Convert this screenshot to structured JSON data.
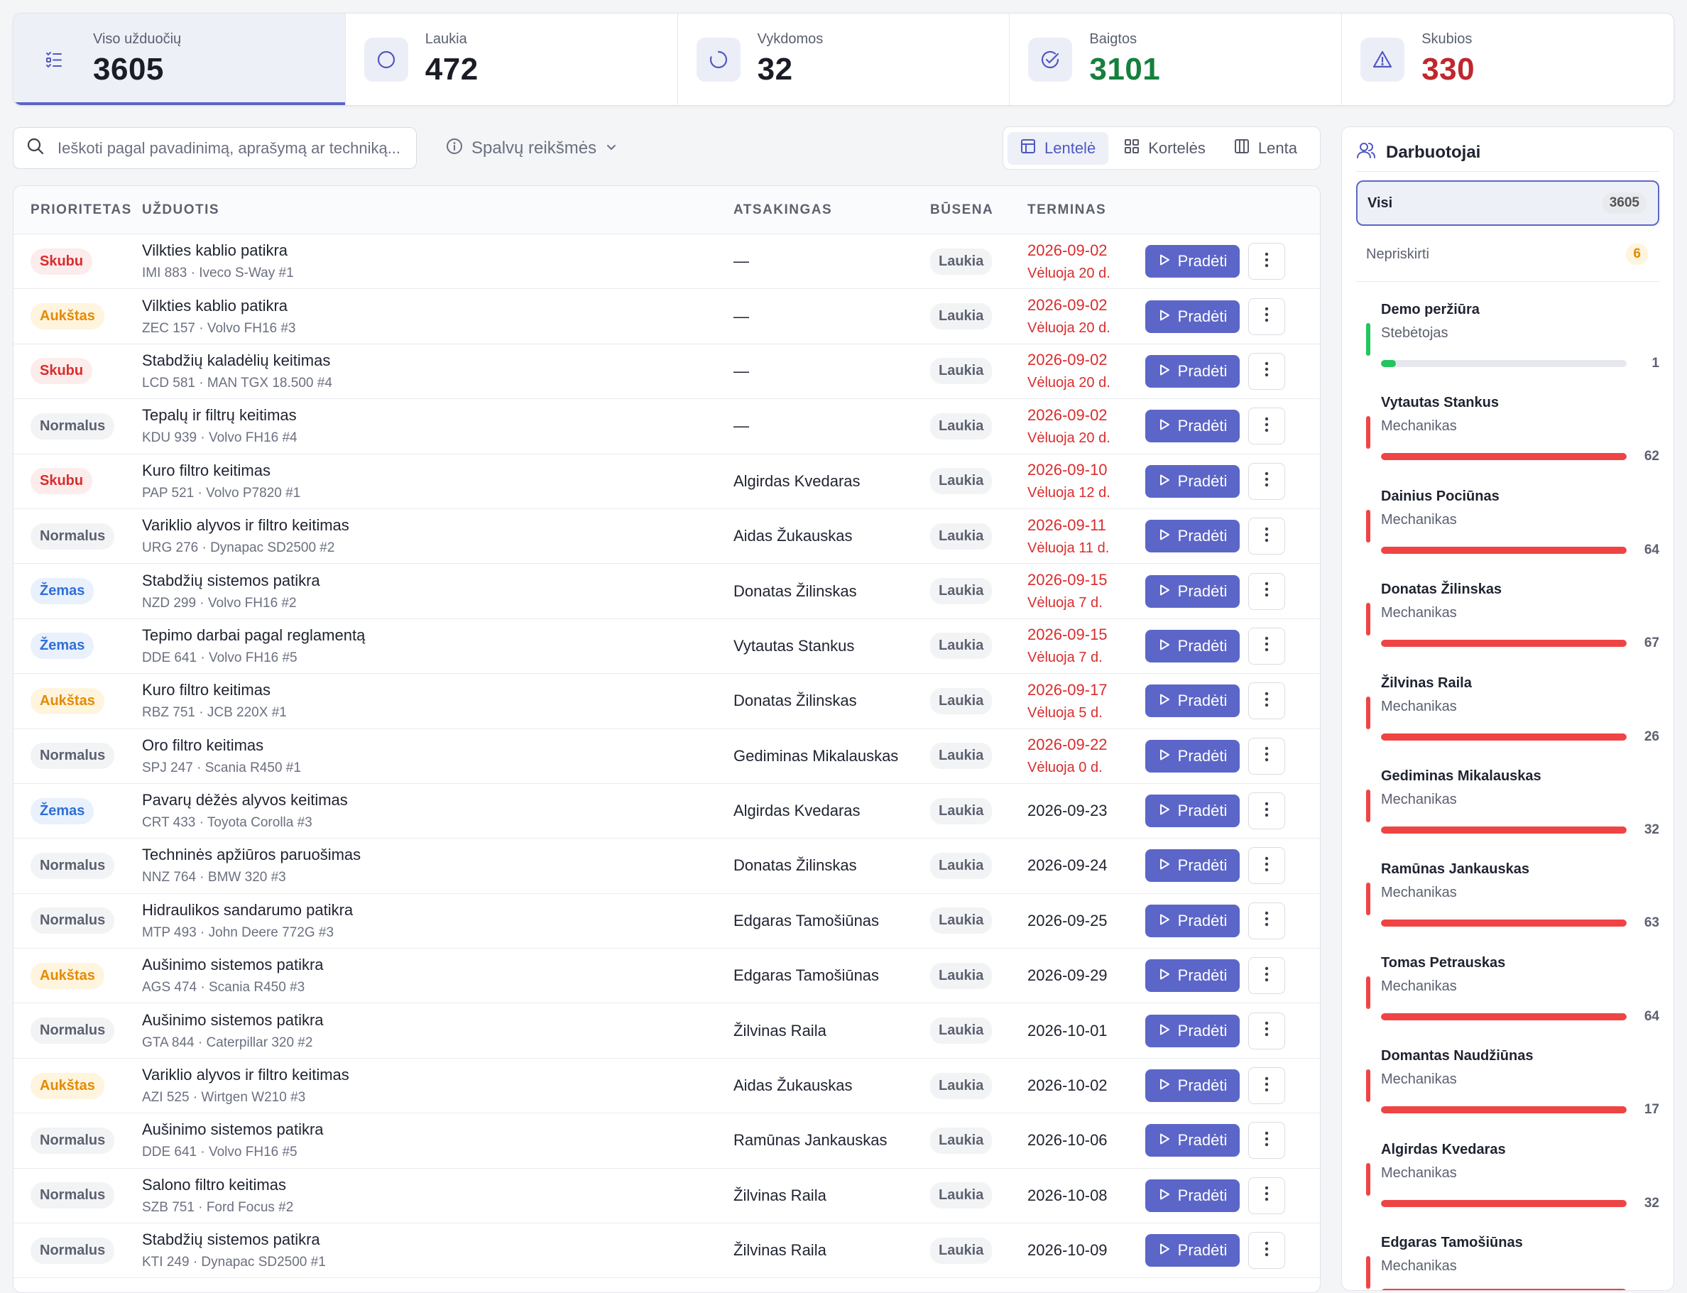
{
  "stats": [
    {
      "label": "Viso užduočių",
      "value": "3605",
      "tone": "default",
      "icon": "checklist-icon",
      "active": true
    },
    {
      "label": "Laukia",
      "value": "472",
      "tone": "default",
      "icon": "circle-icon",
      "active": false
    },
    {
      "label": "Vykdomos",
      "value": "32",
      "tone": "default",
      "icon": "loading-spinner-icon",
      "active": false
    },
    {
      "label": "Baigtos",
      "value": "3101",
      "tone": "green",
      "icon": "check-circle-icon",
      "active": false
    },
    {
      "label": "Skubios",
      "value": "330",
      "tone": "red",
      "icon": "warning-triangle-icon",
      "active": false
    }
  ],
  "search": {
    "placeholder": "Ieškoti pagal pavadinimą, aprašymą ar techniką..."
  },
  "legend_button": {
    "label": "Spalvų reikšmės"
  },
  "views": [
    {
      "label": "Lentelė",
      "icon": "table-icon",
      "active": true
    },
    {
      "label": "Kortelės",
      "icon": "grid-icon",
      "active": false
    },
    {
      "label": "Lenta",
      "icon": "kanban-icon",
      "active": false
    }
  ],
  "table": {
    "headers": {
      "priority": "PRIORITETAS",
      "task": "UŽDUOTIS",
      "assignee": "ATSAKINGAS",
      "status": "BŪSENA",
      "due": "TERMINAS"
    },
    "start_label": "Pradėti",
    "rows": [
      {
        "priority": "Skubu",
        "pclass": "skubu",
        "title": "Vilkties kablio patikra",
        "sub": "IMI 883 · Iveco S-Way #1",
        "assignee": "—",
        "status": "Laukia",
        "due": "2026-09-02",
        "late": "Vėluoja 20 d."
      },
      {
        "priority": "Aukštas",
        "pclass": "aukstas",
        "title": "Vilkties kablio patikra",
        "sub": "ZEC 157 · Volvo FH16 #3",
        "assignee": "—",
        "status": "Laukia",
        "due": "2026-09-02",
        "late": "Vėluoja 20 d."
      },
      {
        "priority": "Skubu",
        "pclass": "skubu",
        "title": "Stabdžių kaladėlių keitimas",
        "sub": "LCD 581 · MAN TGX 18.500 #4",
        "assignee": "—",
        "status": "Laukia",
        "due": "2026-09-02",
        "late": "Vėluoja 20 d."
      },
      {
        "priority": "Normalus",
        "pclass": "normalus",
        "title": "Tepalų ir filtrų keitimas",
        "sub": "KDU 939 · Volvo FH16 #4",
        "assignee": "—",
        "status": "Laukia",
        "due": "2026-09-02",
        "late": "Vėluoja 20 d."
      },
      {
        "priority": "Skubu",
        "pclass": "skubu",
        "title": "Kuro filtro keitimas",
        "sub": "PAP 521 · Volvo P7820 #1",
        "assignee": "Algirdas Kvedaras",
        "status": "Laukia",
        "due": "2026-09-10",
        "late": "Vėluoja 12 d."
      },
      {
        "priority": "Normalus",
        "pclass": "normalus",
        "title": "Variklio alyvos ir filtro keitimas",
        "sub": "URG 276 · Dynapac SD2500 #2",
        "assignee": "Aidas Žukauskas",
        "status": "Laukia",
        "due": "2026-09-11",
        "late": "Vėluoja 11 d."
      },
      {
        "priority": "Žemas",
        "pclass": "zemas",
        "title": "Stabdžių sistemos patikra",
        "sub": "NZD 299 · Volvo FH16 #2",
        "assignee": "Donatas Žilinskas",
        "status": "Laukia",
        "due": "2026-09-15",
        "late": "Vėluoja 7 d."
      },
      {
        "priority": "Žemas",
        "pclass": "zemas",
        "title": "Tepimo darbai pagal reglamentą",
        "sub": "DDE 641 · Volvo FH16 #5",
        "assignee": "Vytautas Stankus",
        "status": "Laukia",
        "due": "2026-09-15",
        "late": "Vėluoja 7 d."
      },
      {
        "priority": "Aukštas",
        "pclass": "aukstas",
        "title": "Kuro filtro keitimas",
        "sub": "RBZ 751 · JCB 220X #1",
        "assignee": "Donatas Žilinskas",
        "status": "Laukia",
        "due": "2026-09-17",
        "late": "Vėluoja 5 d."
      },
      {
        "priority": "Normalus",
        "pclass": "normalus",
        "title": "Oro filtro keitimas",
        "sub": "SPJ 247 · Scania R450 #1",
        "assignee": "Gediminas Mikalauskas",
        "status": "Laukia",
        "due": "2026-09-22",
        "late": "Vėluoja 0 d."
      },
      {
        "priority": "Žemas",
        "pclass": "zemas",
        "title": "Pavarų dėžės alyvos keitimas",
        "sub": "CRT 433 · Toyota Corolla #3",
        "assignee": "Algirdas Kvedaras",
        "status": "Laukia",
        "due": "2026-09-23",
        "late": ""
      },
      {
        "priority": "Normalus",
        "pclass": "normalus",
        "title": "Techninės apžiūros paruošimas",
        "sub": "NNZ 764 · BMW 320 #3",
        "assignee": "Donatas Žilinskas",
        "status": "Laukia",
        "due": "2026-09-24",
        "late": ""
      },
      {
        "priority": "Normalus",
        "pclass": "normalus",
        "title": "Hidraulikos sandarumo patikra",
        "sub": "MTP 493 · John Deere 772G #3",
        "assignee": "Edgaras Tamošiūnas",
        "status": "Laukia",
        "due": "2026-09-25",
        "late": ""
      },
      {
        "priority": "Aukštas",
        "pclass": "aukstas",
        "title": "Aušinimo sistemos patikra",
        "sub": "AGS 474 · Scania R450 #3",
        "assignee": "Edgaras Tamošiūnas",
        "status": "Laukia",
        "due": "2026-09-29",
        "late": ""
      },
      {
        "priority": "Normalus",
        "pclass": "normalus",
        "title": "Aušinimo sistemos patikra",
        "sub": "GTA 844 · Caterpillar 320 #2",
        "assignee": "Žilvinas Raila",
        "status": "Laukia",
        "due": "2026-10-01",
        "late": ""
      },
      {
        "priority": "Aukštas",
        "pclass": "aukstas",
        "title": "Variklio alyvos ir filtro keitimas",
        "sub": "AZI 525 · Wirtgen W210 #3",
        "assignee": "Aidas Žukauskas",
        "status": "Laukia",
        "due": "2026-10-02",
        "late": ""
      },
      {
        "priority": "Normalus",
        "pclass": "normalus",
        "title": "Aušinimo sistemos patikra",
        "sub": "DDE 641 · Volvo FH16 #5",
        "assignee": "Ramūnas Jankauskas",
        "status": "Laukia",
        "due": "2026-10-06",
        "late": ""
      },
      {
        "priority": "Normalus",
        "pclass": "normalus",
        "title": "Salono filtro keitimas",
        "sub": "SZB 751 · Ford Focus #2",
        "assignee": "Žilvinas Raila",
        "status": "Laukia",
        "due": "2026-10-08",
        "late": ""
      },
      {
        "priority": "Normalus",
        "pclass": "normalus",
        "title": "Stabdžių sistemos patikra",
        "sub": "KTI 249 · Dynapac SD2500 #1",
        "assignee": "Žilvinas Raila",
        "status": "Laukia",
        "due": "2026-10-09",
        "late": ""
      }
    ]
  },
  "employees": {
    "title": "Darbuotojai",
    "filters": [
      {
        "label": "Visi",
        "count": "3605",
        "active": true
      },
      {
        "label": "Nepriskirti",
        "count": "6",
        "active": false
      }
    ],
    "list": [
      {
        "name": "Demo peržiūra",
        "role": "Stebėtojas",
        "count": "1",
        "fill": 0.06,
        "color": "#22c55e"
      },
      {
        "name": "Vytautas Stankus",
        "role": "Mechanikas",
        "count": "62",
        "fill": 1.0,
        "color": "#ef4444"
      },
      {
        "name": "Dainius Pociūnas",
        "role": "Mechanikas",
        "count": "64",
        "fill": 1.0,
        "color": "#ef4444"
      },
      {
        "name": "Donatas Žilinskas",
        "role": "Mechanikas",
        "count": "67",
        "fill": 1.0,
        "color": "#ef4444"
      },
      {
        "name": "Žilvinas Raila",
        "role": "Mechanikas",
        "count": "26",
        "fill": 1.0,
        "color": "#ef4444"
      },
      {
        "name": "Gediminas Mikalauskas",
        "role": "Mechanikas",
        "count": "32",
        "fill": 1.0,
        "color": "#ef4444"
      },
      {
        "name": "Ramūnas Jankauskas",
        "role": "Mechanikas",
        "count": "63",
        "fill": 1.0,
        "color": "#ef4444"
      },
      {
        "name": "Tomas Petrauskas",
        "role": "Mechanikas",
        "count": "64",
        "fill": 1.0,
        "color": "#ef4444"
      },
      {
        "name": "Domantas Naudžiūnas",
        "role": "Mechanikas",
        "count": "17",
        "fill": 1.0,
        "color": "#ef4444"
      },
      {
        "name": "Algirdas Kvedaras",
        "role": "Mechanikas",
        "count": "32",
        "fill": 1.0,
        "color": "#ef4444"
      },
      {
        "name": "Edgaras Tamošiūnas",
        "role": "Mechanikas",
        "count": "",
        "fill": 1.0,
        "color": "#ef4444"
      }
    ]
  }
}
